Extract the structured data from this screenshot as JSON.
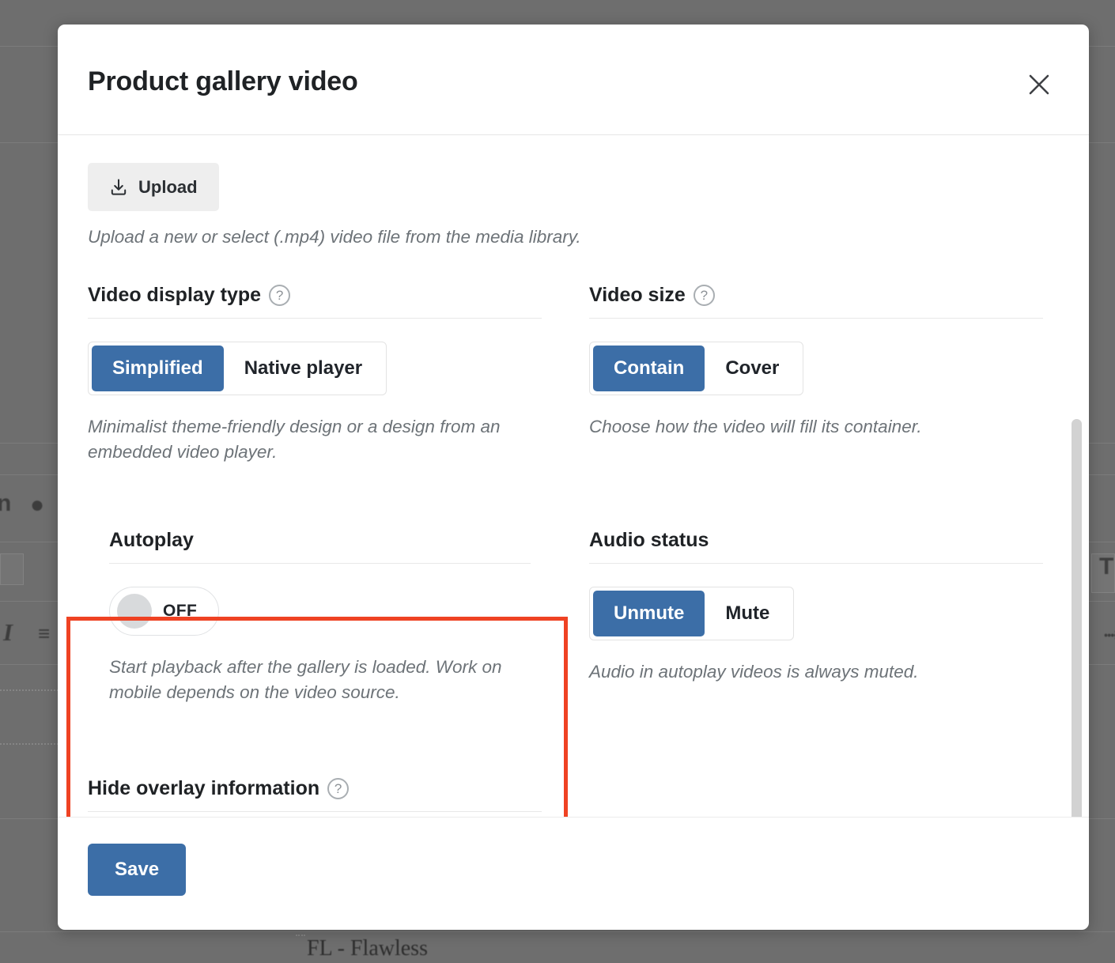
{
  "background": {
    "product_label": "FL - Flawless",
    "overlay_color": "#6e6e6e",
    "bold_glyph": "n",
    "italic_glyph": "I",
    "text_glyph": "T"
  },
  "modal": {
    "title": "Product gallery video",
    "close_icon": "close-icon",
    "upload": {
      "label": "Upload",
      "icon": "upload-icon",
      "hint": "Upload a new or select (.mp4) video file from the media library."
    },
    "fields": [
      {
        "key": "video_display_type",
        "title": "Video display type",
        "has_help": true,
        "help_icon": "help-circle-icon",
        "control": "segmented",
        "options": [
          "Simplified",
          "Native player"
        ],
        "selected": "Simplified",
        "hint": "Minimalist theme-friendly design or a design from an embedded video player."
      },
      {
        "key": "video_size",
        "title": "Video size",
        "has_help": true,
        "help_icon": "help-circle-icon",
        "control": "segmented",
        "options": [
          "Contain",
          "Cover"
        ],
        "selected": "Contain",
        "hint": "Choose how the video will fill its container."
      },
      {
        "key": "autoplay",
        "title": "Autoplay",
        "has_help": false,
        "control": "toggle",
        "state_label": "OFF",
        "state_on": false,
        "hint": "Start playback after the gallery is loaded. Work on mobile depends on the video source.",
        "highlighted": true
      },
      {
        "key": "audio_status",
        "title": "Audio status",
        "has_help": false,
        "control": "segmented",
        "options": [
          "Unmute",
          "Mute"
        ],
        "selected": "Unmute",
        "hint": "Audio in autoplay videos is always muted."
      },
      {
        "key": "hide_overlay_information",
        "title": "Hide overlay information",
        "has_help": true,
        "help_icon": "help-circle-icon",
        "control": "none",
        "hint": ""
      }
    ],
    "footer": {
      "save_label": "Save"
    },
    "scrollbar": {
      "orientation": "vertical"
    }
  },
  "colors": {
    "accent_blue": "#3c6ea7",
    "highlight_red": "#ef4223",
    "toggle_knob": "#d8dadc",
    "hint_text": "#6d7378"
  }
}
